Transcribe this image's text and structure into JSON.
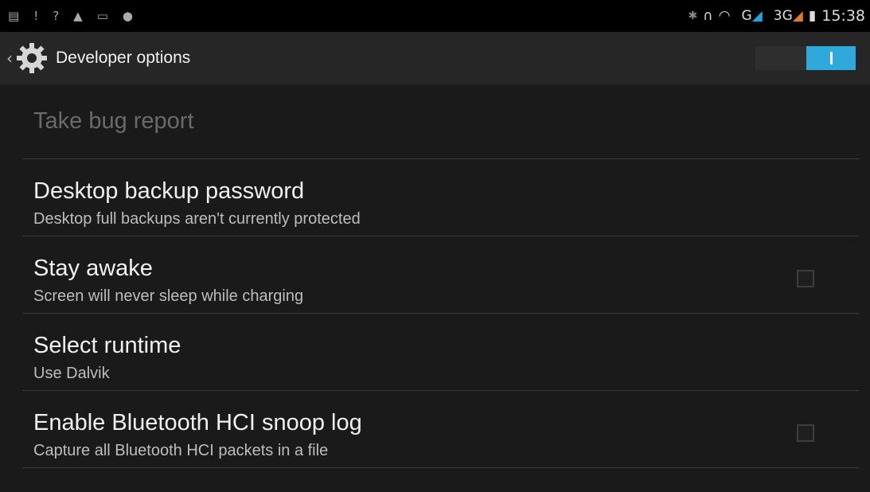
{
  "status_bar": {
    "left_icons": [
      "message-icon",
      "alert-icon",
      "wifi-question-icon",
      "lock-icon",
      "screenshot-icon",
      "chat-icon"
    ],
    "right_icons": [
      "bluetooth-icon",
      "headphones-icon",
      "wifi-icon",
      "g-signal-icon",
      "3g-signal-icon",
      "battery-icon"
    ],
    "network_g": "G",
    "network_3g": "3G",
    "time": "15:38"
  },
  "action_bar": {
    "title": "Developer options",
    "master_switch_on": true
  },
  "settings": [
    {
      "title": "Take bug report",
      "subtitle": "",
      "enabled": false,
      "has_checkbox": false
    },
    {
      "title": "Desktop backup password",
      "subtitle": "Desktop full backups aren't currently protected",
      "enabled": true,
      "has_checkbox": false
    },
    {
      "title": "Stay awake",
      "subtitle": "Screen will never sleep while charging",
      "enabled": true,
      "has_checkbox": true,
      "checked": false
    },
    {
      "title": "Select runtime",
      "subtitle": "Use Dalvik",
      "enabled": true,
      "has_checkbox": false
    },
    {
      "title": "Enable Bluetooth HCI snoop log",
      "subtitle": "Capture all Bluetooth HCI packets in a file",
      "enabled": true,
      "has_checkbox": true,
      "checked": false
    }
  ],
  "colors": {
    "accent": "#2fa8dc",
    "background": "#1a1a1a",
    "action_bar": "#262626"
  }
}
